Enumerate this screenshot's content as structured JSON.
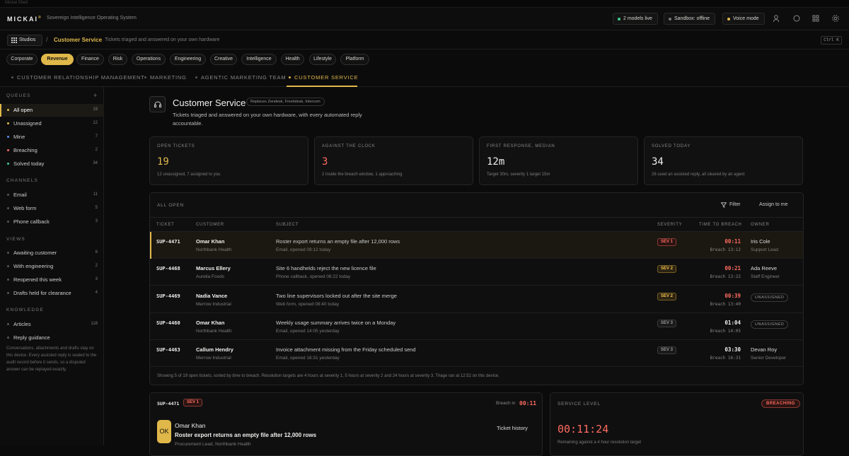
{
  "window": {
    "title": "Mickai Shell"
  },
  "brand": {
    "name": "MICKAI",
    "mark": "®",
    "tagline": "Sovereign Intelligence Operating System"
  },
  "topbar": {
    "models_live": "2 models live",
    "sandbox": "Sandbox: offline",
    "voice": "Voice mode",
    "colors": {
      "models": "#3ecf8e",
      "sandbox": "#777777",
      "voice": "#e0b84a"
    }
  },
  "crumb": {
    "studios": "Studios",
    "sep": "/",
    "title": "Customer Service",
    "sub": "Tickets triaged and answered on your own hardware",
    "shortcut": "Ctrl K"
  },
  "categories": [
    "Corporate",
    "Revenue",
    "Finance",
    "Risk",
    "Operations",
    "Engineering",
    "Creative",
    "Intelligence",
    "Health",
    "Lifestyle",
    "Platform"
  ],
  "active_category": "Revenue",
  "tabs": [
    "CUSTOMER RELATIONSHIP MANAGEMENT",
    "MARKETING",
    "AGENTIC MARKETING TEAM",
    "CUSTOMER SERVICE"
  ],
  "active_tab": "CUSTOMER SERVICE",
  "sidebar": {
    "queues_title": "QUEUES",
    "queues": [
      {
        "label": "All open",
        "count": "19",
        "color": "#e0b84a"
      },
      {
        "label": "Unassigned",
        "count": "12",
        "color": "#e0b84a"
      },
      {
        "label": "Mine",
        "count": "7",
        "color": "#5b8def"
      },
      {
        "label": "Breaching",
        "count": "2",
        "color": "#ff6b5f"
      },
      {
        "label": "Solved today",
        "count": "34",
        "color": "#3ecf8e"
      }
    ],
    "channels_title": "CHANNELS",
    "channels": [
      {
        "label": "Email",
        "count": "11"
      },
      {
        "label": "Web form",
        "count": "5"
      },
      {
        "label": "Phone callback",
        "count": "3"
      }
    ],
    "views_title": "VIEWS",
    "views": [
      {
        "label": "Awaiting customer",
        "count": "6"
      },
      {
        "label": "With engineering",
        "count": "2"
      },
      {
        "label": "Reopened this week",
        "count": "3"
      },
      {
        "label": "Drafts held for clearance",
        "count": "4"
      }
    ],
    "knowledge_title": "KNOWLEDGE",
    "knowledge": [
      {
        "label": "Articles",
        "count": "118"
      },
      {
        "label": "Reply guidance",
        "count": ""
      }
    ],
    "note": "Conversations, attachments and drafts stay on this device. Every assisted reply is sealed to the audit record before it sends, so a disputed answer can be replayed exactly."
  },
  "header": {
    "title": "Customer Service",
    "replaces": "Replaces Zendesk, Freshdesk, Intercom",
    "subtitle": "Tickets triaged and answered on your own hardware, with every automated reply accountable."
  },
  "stats": [
    {
      "label": "OPEN TICKETS",
      "value": "19",
      "note": "12 unassigned, 7 assigned to you",
      "color": "#e0b84a"
    },
    {
      "label": "AGAINST THE CLOCK",
      "value": "3",
      "note": "2 inside the breach window, 1 approaching",
      "color": "#ff6b5f"
    },
    {
      "label": "FIRST RESPONSE, MEDIAN",
      "value": "12m",
      "note": "Target 30m, severity 1 target 15m",
      "color": "#eeeeee"
    },
    {
      "label": "SOLVED TODAY",
      "value": "34",
      "note": "26 used an assisted reply, all cleared by an agent",
      "color": "#eeeeee"
    }
  ],
  "table": {
    "title": "ALL OPEN",
    "filter": "Filter",
    "assign": "Assign to me",
    "columns": [
      "TICKET",
      "CUSTOMER",
      "SUBJECT",
      "SEVERITY",
      "TIME TO BREACH",
      "OWNER"
    ],
    "rows": [
      {
        "id": "SUP-4471",
        "customer": "Omar Khan",
        "org": "Northbank Health",
        "subject": "Roster export returns an empty file after 12,000 rows",
        "meta": "Email, opened 09:12 today",
        "sev": "SEV 1",
        "ttb": "00:11",
        "breach": "Breach 13:12",
        "owner": "Iris Cole",
        "role": "Support Lead"
      },
      {
        "id": "SUP-4468",
        "customer": "Marcus Ellery",
        "org": "Aurelia Foods",
        "subject": "Site 6 handhelds reject the new licence file",
        "meta": "Phone callback, opened 08:22 today",
        "sev": "SEV 2",
        "ttb": "00:21",
        "breach": "Breach 13:22",
        "owner": "Ada Reeve",
        "role": "Staff Engineer"
      },
      {
        "id": "SUP-4469",
        "customer": "Nadia Vance",
        "org": "Merrow Industrial",
        "subject": "Two line supervisors locked out after the site merge",
        "meta": "Web form, opened 08:40 today",
        "sev": "SEV 2",
        "ttb": "00:39",
        "breach": "Breach 13:40",
        "owner": "UNASSIGNED",
        "role": ""
      },
      {
        "id": "SUP-4460",
        "customer": "Omar Khan",
        "org": "Northbank Health",
        "subject": "Weekly usage summary arrives twice on a Monday",
        "meta": "Email, opened 14:05 yesterday",
        "sev": "SEV 3",
        "ttb": "01:04",
        "breach": "Breach 14:05",
        "owner": "UNASSIGNED",
        "role": ""
      },
      {
        "id": "SUP-4463",
        "customer": "Callum Hendry",
        "org": "Merrow Industrial",
        "subject": "Invoice attachment missing from the Friday scheduled send",
        "meta": "Email, opened 16:31 yesterday",
        "sev": "SEV 3",
        "ttb": "03:30",
        "breach": "Breach 16:31",
        "owner": "Devan Roy",
        "role": "Senior Developer"
      }
    ],
    "footer": "Showing 5 of 19 open tickets, sorted by time to breach. Resolution targets are 4 hours at severity 1, 5 hours at severity 2 and 24 hours at severity 3. Triage ran at 12:52 on this device."
  },
  "detail": {
    "id": "SUP-4471",
    "sev": "SEV 1",
    "breach_label": "Breach in",
    "breach_value": "00:11",
    "avatar": "OK",
    "name": "Omar Khan",
    "subject": "Roster export returns an empty file after 12,000 rows",
    "org": "Procurement Lead, Northbank Health",
    "history": "Ticket history"
  },
  "service": {
    "title": "SERVICE LEVEL",
    "badge": "BREACHING",
    "timer": "00:11:24",
    "note": "Remaining against a 4 hour resolution target"
  }
}
